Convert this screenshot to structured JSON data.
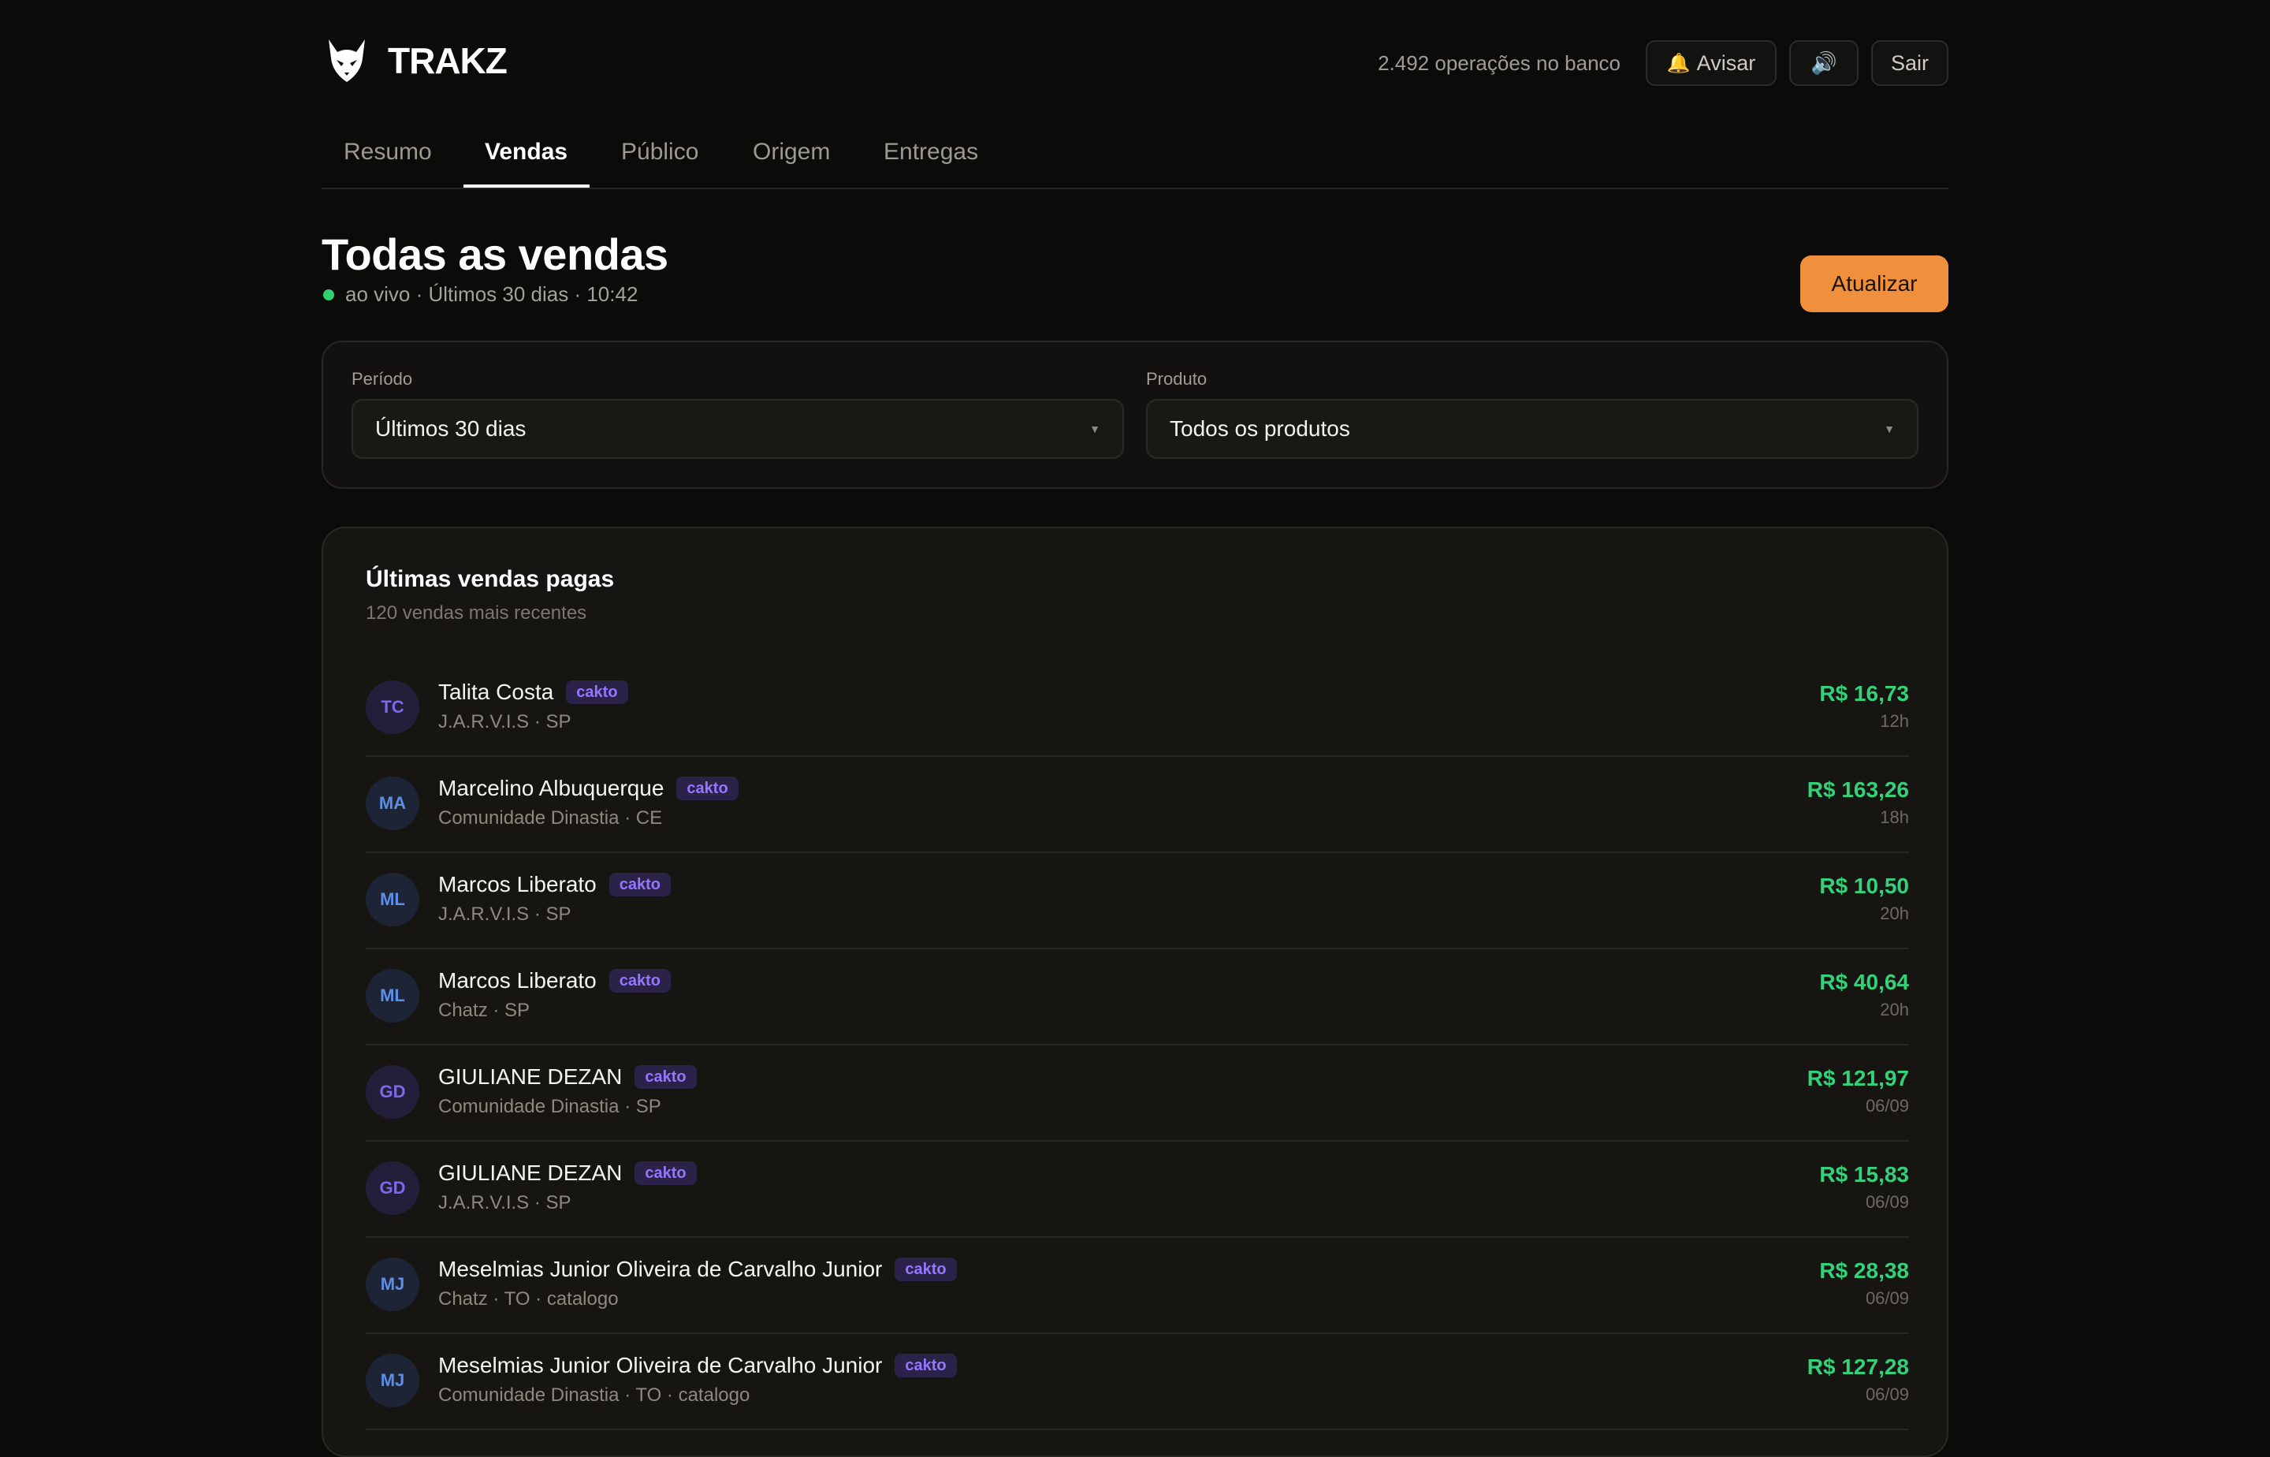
{
  "header": {
    "brand": "TRAKZ",
    "logo_icon": "horned-mask-logo",
    "ops_count": "2.492 operações no banco",
    "avisar_label": "Avisar",
    "avisar_icon": "🔔",
    "sound_icon": "🔊",
    "sair_label": "Sair"
  },
  "tabs": [
    {
      "label": "Resumo",
      "active": false
    },
    {
      "label": "Vendas",
      "active": true
    },
    {
      "label": "Público",
      "active": false
    },
    {
      "label": "Origem",
      "active": false
    },
    {
      "label": "Entregas",
      "active": false
    }
  ],
  "page": {
    "title": "Todas as vendas",
    "live": "ao vivo",
    "period": "Últimos 30 dias",
    "time": "10:42",
    "update_label": "Atualizar"
  },
  "filters": {
    "period_label": "Período",
    "period_value": "Últimos 30 dias",
    "product_label": "Produto",
    "product_value": "Todos os produtos"
  },
  "sales": {
    "title": "Últimas vendas pagas",
    "subtitle": "120 vendas mais recentes",
    "rows": [
      {
        "initials": "TC",
        "name": "Talita Costa",
        "badge": "cakto",
        "meta": "J.A.R.V.I.S · SP",
        "amount": "R$ 16,73",
        "time": "12h"
      },
      {
        "initials": "MA",
        "name": "Marcelino Albuquerque",
        "badge": "cakto",
        "meta": "Comunidade Dinastia · CE",
        "amount": "R$ 163,26",
        "time": "18h"
      },
      {
        "initials": "ML",
        "name": "Marcos Liberato",
        "badge": "cakto",
        "meta": "J.A.R.V.I.S · SP",
        "amount": "R$ 10,50",
        "time": "20h"
      },
      {
        "initials": "ML",
        "name": "Marcos Liberato",
        "badge": "cakto",
        "meta": "Chatz · SP",
        "amount": "R$ 40,64",
        "time": "20h"
      },
      {
        "initials": "GD",
        "name": "GIULIANE DEZAN",
        "badge": "cakto",
        "meta": "Comunidade Dinastia · SP",
        "amount": "R$ 121,97",
        "time": "06/09"
      },
      {
        "initials": "GD",
        "name": "GIULIANE DEZAN",
        "badge": "cakto",
        "meta": "J.A.R.V.I.S · SP",
        "amount": "R$ 15,83",
        "time": "06/09"
      },
      {
        "initials": "MJ",
        "name": "Meselmias Junior Oliveira de Carvalho Junior",
        "badge": "cakto",
        "meta": "Chatz · TO · catalogo",
        "amount": "R$ 28,38",
        "time": "06/09"
      },
      {
        "initials": "MJ",
        "name": "Meselmias Junior Oliveira de Carvalho Junior",
        "badge": "cakto",
        "meta": "Comunidade Dinastia · TO · catalogo",
        "amount": "R$ 127,28",
        "time": "06/09"
      }
    ]
  },
  "colors": {
    "accent": "#f0903c",
    "positive": "#35d17a",
    "live": "#2fd26e",
    "badge": "#9378ff"
  }
}
